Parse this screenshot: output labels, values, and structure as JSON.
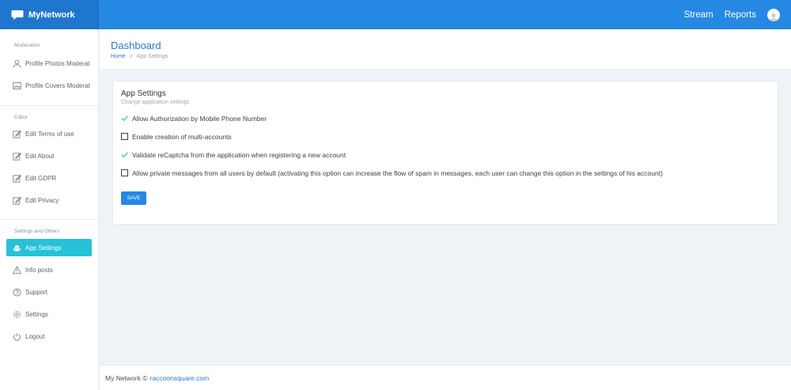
{
  "app": {
    "name": "MyNetwork"
  },
  "topbar": {
    "links": [
      {
        "label": "Stream"
      },
      {
        "label": "Reports"
      }
    ]
  },
  "sidebar": {
    "sections": [
      {
        "title": "Moderation",
        "items": [
          "Profile Photos Moderat",
          "Profile Covers Moderat"
        ]
      },
      {
        "title": "Editor",
        "items": [
          "Edit Terms of use",
          "Edit About",
          "Edit GDPR",
          "Edit Privacy"
        ]
      },
      {
        "title": "Settings and Others",
        "items": [
          "App Settings",
          "Info posts",
          "Support",
          "Settings",
          "Logout"
        ]
      }
    ],
    "active_item": "App Settings"
  },
  "page": {
    "title": "Dashboard",
    "breadcrumb": {
      "home": "Home",
      "separator": ">",
      "current": "App Settings"
    }
  },
  "settings_card": {
    "title": "App Settings",
    "subtitle": "Change application settings",
    "options": [
      {
        "label": "Allow Authorization by Mobile Phone Number",
        "checked": true
      },
      {
        "label": "Enable creation of multi-accounts",
        "checked": false
      },
      {
        "label": "Validate reCaptcha from the application when registering a new account",
        "checked": true
      },
      {
        "label": "Allow private messages from all users by default (activating this option can increase the flow of spam in messages, each user can change this option in the settings of his account)",
        "checked": false
      }
    ],
    "save_label": "SAVE"
  },
  "footer": {
    "text": "My Network ©",
    "link": "raccoonsquare.com"
  },
  "colors": {
    "primary": "#2588e3",
    "active": "#27c2d8",
    "check": "#2fb8c8"
  }
}
